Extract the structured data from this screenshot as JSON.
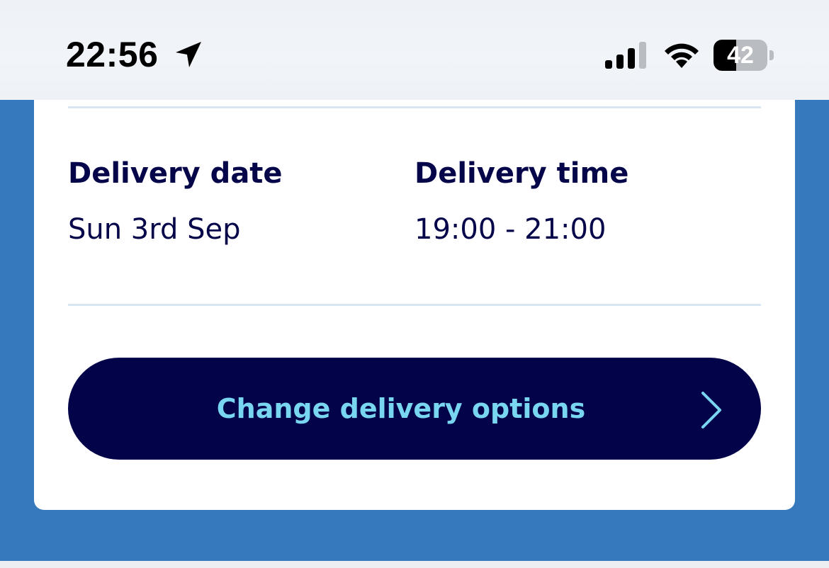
{
  "status_bar": {
    "time": "22:56",
    "battery_level": 42,
    "battery_label": "42",
    "icons": [
      "location-arrow-icon",
      "cellular-signal-icon",
      "wifi-icon",
      "battery-icon"
    ]
  },
  "delivery": {
    "date_label": "Delivery date",
    "date_value": "Sun 3rd Sep",
    "time_label": "Delivery time",
    "time_value": "19:00 - 21:00"
  },
  "actions": {
    "change_options_label": "Change delivery options",
    "chevron_icon": "chevron-right-icon"
  },
  "colors": {
    "background_blue": "#3679bd",
    "navy": "#05054a",
    "button_navy": "#03034a",
    "button_text": "#79d6f0",
    "divider": "#d7e6f2",
    "card": "#ffffff"
  }
}
